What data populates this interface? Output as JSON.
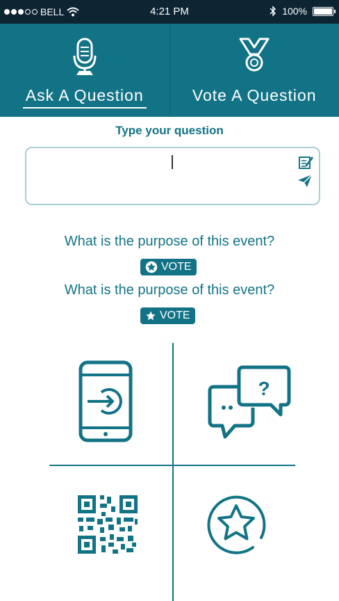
{
  "status_bar": {
    "carrier": "BELL",
    "time": "4:21 PM",
    "battery": "100%"
  },
  "tabs": [
    {
      "label": "Ask A Question",
      "icon": "microphone-icon",
      "active": true
    },
    {
      "label": "Vote A Question",
      "icon": "medal-icon",
      "active": false
    }
  ],
  "question_input": {
    "prompt": "Type your question",
    "value": "",
    "edit_icon": "edit-icon",
    "send_icon": "send-icon"
  },
  "questions": [
    {
      "text": "What is the purpose of this event?",
      "vote_label": "VOTE"
    },
    {
      "text": "What is the purpose of this event?",
      "vote_label": "VOTE"
    }
  ],
  "tiles": [
    {
      "icon": "phone-login-icon"
    },
    {
      "icon": "chat-question-icon"
    },
    {
      "icon": "qr-code-icon"
    },
    {
      "icon": "star-circle-icon"
    }
  ],
  "colors": {
    "primary": "#137386",
    "status_bar": "#0d2433",
    "input_border": "#a9cfd6"
  }
}
